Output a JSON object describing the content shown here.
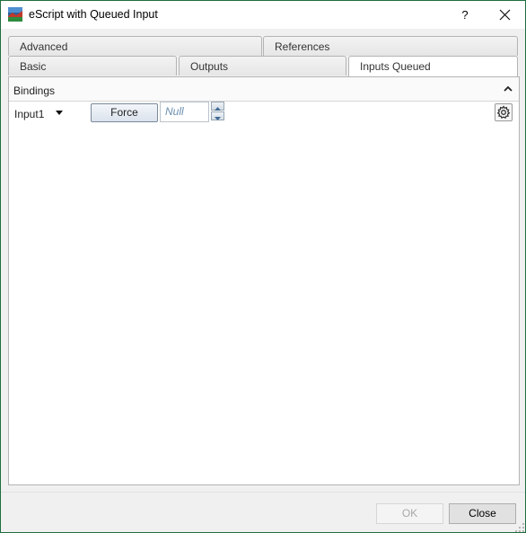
{
  "window": {
    "title": "eScript with Queued Input",
    "help_label": "?",
    "icons": {
      "app": "app-icon",
      "close": "close-icon"
    }
  },
  "tabs": {
    "row1": [
      {
        "label": "Advanced"
      },
      {
        "label": "References"
      }
    ],
    "row2": [
      {
        "label": "Basic"
      },
      {
        "label": "Outputs"
      },
      {
        "label": "Inputs Queued",
        "active": true
      }
    ]
  },
  "bindings": {
    "title": "Bindings",
    "input_label": "Input1",
    "force_label": "Force",
    "value_placeholder": "Null",
    "icons": {
      "collapse": "chevron-up-icon",
      "dropdown": "dropdown-arrow-icon",
      "settings": "gear-icon"
    }
  },
  "footer": {
    "ok_label": "OK",
    "close_label": "Close",
    "ok_enabled": false
  },
  "colors": {
    "window_border": "#1f6f3f",
    "placeholder_text": "#6a8fb0",
    "button_face": "#e1e1e1"
  }
}
